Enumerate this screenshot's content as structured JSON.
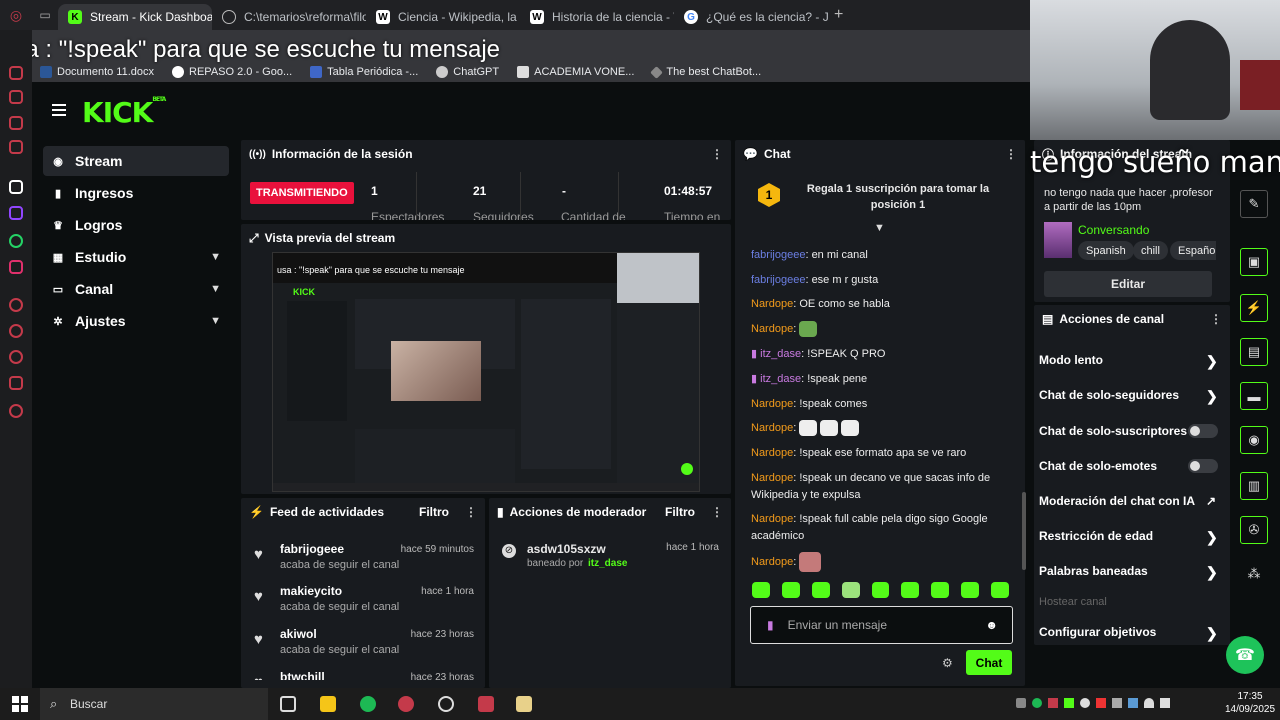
{
  "browser": {
    "tabs": [
      {
        "label": "Stream - Kick Dashboard",
        "active": true,
        "icon": "kick-icon"
      },
      {
        "label": "C:\\temarios\\reforma\\filo\\",
        "active": false,
        "icon": "globe-icon"
      },
      {
        "label": "Ciencia - Wikipedia, la en",
        "active": false,
        "icon": "wikipedia-icon"
      },
      {
        "label": "Historia de la ciencia - W",
        "active": false,
        "icon": "wikipedia-icon"
      },
      {
        "label": "¿Qué es la ciencia? - John",
        "active": false,
        "icon": "google-icon"
      }
    ],
    "bookmarks": [
      "Documento 11.docx",
      "REPASO 2.0 - Goo...",
      "Tabla Periódica -...",
      "ChatGPT",
      "ACADEMIA VONE...",
      "The best ChatBot..."
    ]
  },
  "overlay_text": "usa : \"!speak\" para que se escuche tu mensaje",
  "webcam_caption": "tengo sueño mano",
  "nav": [
    {
      "label": "Stream",
      "icon": "stream-icon",
      "active": true
    },
    {
      "label": "Ingresos",
      "icon": "chart-icon"
    },
    {
      "label": "Logros",
      "icon": "trophy-icon"
    },
    {
      "label": "Estudio",
      "icon": "grid-icon",
      "chevron": true
    },
    {
      "label": "Canal",
      "icon": "monitor-icon",
      "chevron": true
    },
    {
      "label": "Ajustes",
      "icon": "gear-icon",
      "chevron": true
    }
  ],
  "session": {
    "title": "Información de la sesión",
    "status": "TRANSMITIENDO",
    "stats": [
      {
        "value": "1",
        "label": "Espectadores"
      },
      {
        "value": "21",
        "label": "Seguidores"
      },
      {
        "value": "-",
        "label": "Cantidad de"
      },
      {
        "value": "01:48:57",
        "label": "Tiempo en"
      }
    ]
  },
  "preview": {
    "title": "Vista previa del stream"
  },
  "feed": {
    "title": "Feed de actividades",
    "filter": "Filtro",
    "items": [
      {
        "name": "fabrijogeee",
        "time": "hace 59 minutos",
        "action": "acaba de seguir el canal"
      },
      {
        "name": "makieycito",
        "time": "hace 1 hora",
        "action": "acaba de seguir el canal"
      },
      {
        "name": "akiwol",
        "time": "hace 23 horas",
        "action": "acaba de seguir el canal"
      },
      {
        "name": "btwchill",
        "time": "hace 23 horas",
        "action": ""
      }
    ]
  },
  "mod": {
    "title": "Acciones de moderador",
    "filter": "Filtro",
    "items": [
      {
        "name": "asdw105sxzw",
        "time": "hace 1 hora",
        "action": "baneado por",
        "by": "itz_dase"
      }
    ]
  },
  "chat": {
    "title": "Chat",
    "promo": {
      "badge": "1",
      "text": "Regala 1 suscripción para tomar la posición 1"
    },
    "messages": [
      {
        "user": "fabrijogeee",
        "cls": "u1",
        "text": "en mi canal"
      },
      {
        "user": "fabrijogeee",
        "cls": "u1",
        "text": "ese m r gusta"
      },
      {
        "user": "Nardope",
        "cls": "u2",
        "text": "OE como se habla"
      },
      {
        "user": "Nardope",
        "cls": "u2",
        "text": ""
      },
      {
        "user": "itz_dase",
        "cls": "u3",
        "text": "!SPEAK Q PRO"
      },
      {
        "user": "itz_dase",
        "cls": "u3",
        "text": "!speak pene"
      },
      {
        "user": "Nardope",
        "cls": "u2",
        "text": "!speak comes"
      },
      {
        "user": "Nardope",
        "cls": "u2",
        "text": ""
      },
      {
        "user": "Nardope",
        "cls": "u2",
        "text": "!speak ese formato apa se ve raro"
      },
      {
        "user": "Nardope",
        "cls": "u2",
        "text": "!speak un decano ve que sacas info de Wikipedia y te expulsa"
      },
      {
        "user": "Nardope",
        "cls": "u2",
        "text": "!speak full cable pela digo sigo Google académico"
      },
      {
        "user": "Nardope",
        "cls": "u2",
        "text": ""
      }
    ],
    "placeholder": "Enviar un mensaje",
    "send": "Chat"
  },
  "stream_info": {
    "title": "Información del stream",
    "description": "no tengo nada que hacer ,profesor a partir de las 10pm",
    "category": "Conversando",
    "tags": [
      "Spanish",
      "chill",
      "Españo"
    ],
    "edit": "Editar"
  },
  "channel_actions": {
    "title": "Acciones de canal",
    "items": [
      {
        "label": "Modo lento",
        "control": "arrow"
      },
      {
        "label": "Chat de solo-seguidores",
        "control": "arrow"
      },
      {
        "label": "Chat de solo-suscriptores",
        "control": "toggle"
      },
      {
        "label": "Chat de solo-emotes",
        "control": "toggle"
      },
      {
        "label": "Moderación del chat con IA",
        "control": "external"
      },
      {
        "label": "Restricción de edad",
        "control": "arrow"
      },
      {
        "label": "Palabras baneadas",
        "control": "arrow"
      },
      {
        "label": "Hostear canal",
        "control": "disabled"
      },
      {
        "label": "Configurar objetivos",
        "control": "arrow"
      }
    ]
  },
  "taskbar": {
    "search": "Buscar",
    "time": "17:35",
    "date": "14/09/2025"
  },
  "colors": {
    "accent": "#53fc18",
    "live": "#e9113c",
    "bg": "#0b0e0f",
    "panel": "#181b1f"
  }
}
